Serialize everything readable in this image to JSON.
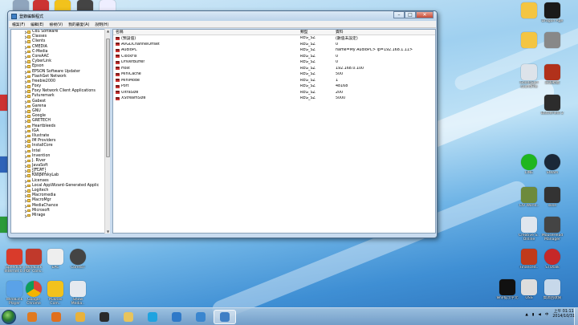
{
  "window": {
    "title": "登錄編輯程式",
    "buttons": {
      "minimize": "–",
      "maximize": "□",
      "close": "✕"
    },
    "menu": [
      "檔案(F)",
      "編輯(E)",
      "檢視(V)",
      "我的最愛(A)",
      "說明(H)"
    ]
  },
  "tree": {
    "items": [
      "CBS Software",
      "Classes",
      "Clients",
      "CMEDIA",
      "C-Media",
      "CoreAAC",
      "CyberLink",
      "Epson",
      "EPSON Software Updater",
      "FlashGet Network",
      "freebie2000",
      "Foxy",
      "Foxy Network Client Applications",
      "Futuremark",
      "Gabest",
      "Garena",
      "GNU",
      "Google",
      "GRETECH",
      "Heartbleeds",
      "IGA",
      "Illustrate",
      "IM Providers",
      "InstallCore",
      "Intel",
      "Invention",
      "J. River",
      "JavaSoft",
      "JFLAY",
      "KasperskyLab",
      "Licenses",
      "Local AppWizard-Generated Applic",
      "Logitech",
      "Macromedia",
      "MacroMgr",
      "MediaChance",
      "Microsoft",
      "Mirage"
    ],
    "selected_index": 28
  },
  "list": {
    "headers": [
      "名稱",
      "類型",
      "資料"
    ],
    "rows": [
      {
        "name": "(預設值)",
        "type": "REG_SZ",
        "data": "(數值未設定)"
      },
      {
        "name": "AVGDChannelOffset",
        "type": "REG_SZ",
        "data": "0"
      },
      {
        "name": "AudioPC",
        "type": "REG_SZ",
        "data": "name=My AudioPC> ip=192.168.1.11>"
      },
      {
        "name": "ClockFix",
        "type": "REG_SZ",
        "data": "0"
      },
      {
        "name": "DriverBuffer",
        "type": "REG_SZ",
        "data": "0"
      },
      {
        "name": "Host",
        "type": "REG_SZ",
        "data": "192.168.0.100"
      },
      {
        "name": "MiniCache",
        "type": "REG_SZ",
        "data": "500"
      },
      {
        "name": "MiniMode",
        "type": "REG_SZ",
        "data": "1"
      },
      {
        "name": "Port",
        "type": "REG_SZ",
        "data": "48168"
      },
      {
        "name": "UltraSize",
        "type": "REG_SZ",
        "data": "200"
      },
      {
        "name": "XStreamSize",
        "type": "REG_SZ",
        "data": "5000"
      }
    ]
  },
  "desktop_icons": [
    {
      "label": "SpeedFan\nInternet 0..",
      "color": "#d93b2b",
      "icon": "speedfan-icon"
    },
    {
      "label": "WinaLink\nPDF Conv..",
      "color": "#c0392b",
      "icon": "pdf-icon"
    },
    {
      "label": "EAC\n",
      "color": "#eeeeee",
      "icon": "eac-icon"
    },
    {
      "label": "CoretoT",
      "color": "#444444",
      "icon": "gear-icon"
    },
    {
      "label": "WinaLink\nPlayer",
      "color": "#5aa2e8",
      "icon": "player-icon"
    },
    {
      "label": "Google\nChrome",
      "color": "#e9b23b",
      "icon": "chrome-icon"
    },
    {
      "label": "PCkitas\nCom..",
      "color": "#f2c21c",
      "icon": "pckit-icon"
    },
    {
      "label": "Show\nMedia..",
      "color": "#e5e9ef",
      "icon": "show-media-icon"
    },
    {
      "label": "",
      "color": "#f4c542",
      "icon": "file-icon"
    },
    {
      "label": "Dragon Age",
      "color": "#1a1a1a",
      "icon": "dragon-age-icon"
    },
    {
      "label": "",
      "color": "#f4c542",
      "icon": "file-icon"
    },
    {
      "label": "",
      "color": "#888888",
      "icon": "app-icon"
    },
    {
      "label": "GoodsEarl\nsoundFile",
      "color": "#dde3ea",
      "icon": "sound-icon"
    },
    {
      "label": "記帳軟體",
      "color": "#b1311b",
      "icon": "ledger-icon"
    },
    {
      "label": "BattleField 2",
      "color": "#2c2c2c",
      "icon": "battlefield-icon"
    },
    {
      "label": "LINE",
      "color": "#1fb61f",
      "icon": "line-icon"
    },
    {
      "label": "Steam",
      "color": "#1b2838",
      "icon": "steam-icon"
    },
    {
      "label": "CIV World..",
      "color": "#6d8a3c",
      "icon": "civ-icon"
    },
    {
      "label": "skse",
      "color": "#333333",
      "icon": "skyrim-icon"
    },
    {
      "label": "Creative S..\nOnline",
      "color": "#dfe6ee",
      "icon": "creative-icon"
    },
    {
      "label": "MouseHead\nManager",
      "color": "#444444",
      "icon": "mouse-icon"
    },
    {
      "label": "Financed..",
      "color": "#c03a1a",
      "icon": "finance-icon"
    },
    {
      "label": "STOtalk",
      "color": "#c62828",
      "icon": "sto-icon"
    },
    {
      "label": "命令提示字元",
      "color": "#111111",
      "icon": "cmd-icon"
    },
    {
      "label": "OSS",
      "color": "#dddddd",
      "icon": "oss-icon"
    },
    {
      "label": "資源回收筒",
      "color": "#c7d8ea",
      "icon": "recycle-bin-icon"
    }
  ],
  "taskbar": {
    "apps": [
      {
        "icon": "media-player-icon",
        "color": "#e07a20"
      },
      {
        "icon": "firefox-icon",
        "color": "#e0701e"
      },
      {
        "icon": "chrome-icon",
        "color": "#e9b23b"
      },
      {
        "icon": "alienware-icon",
        "color": "#2b2b2b"
      },
      {
        "icon": "explorer-icon",
        "color": "#e8c45c"
      },
      {
        "icon": "skype-icon",
        "color": "#1fa3e0"
      },
      {
        "icon": "ie-icon",
        "color": "#2f79c8"
      },
      {
        "icon": "media-icon",
        "color": "#3a86cf"
      },
      {
        "icon": "regedit-icon",
        "color": "#3f7fc5",
        "active": true
      }
    ],
    "tray": {
      "lang": "中",
      "clock_time": "上午 01:11",
      "clock_date": "2014/10/31"
    }
  }
}
